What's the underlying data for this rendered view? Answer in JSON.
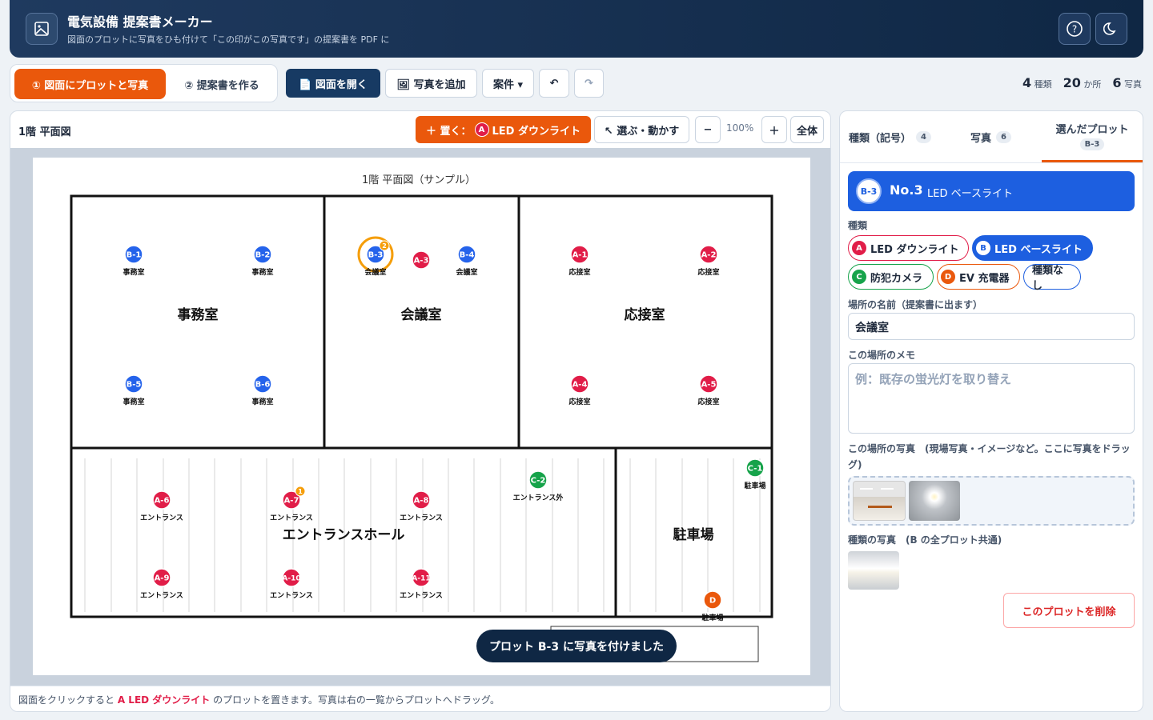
{
  "header": {
    "title": "電気設備 提案書メーカー",
    "subtitle": "図面のプロットに写真をひも付けて「この印がこの写真です」の提案書を PDF に"
  },
  "toolbar": {
    "step1": "① 図面にプロットと写真",
    "step2": "② 提案書を作る",
    "open": "📄 図面を開く",
    "add_photo": "🖼 写真を追加",
    "project": "案件 ▾",
    "undo": "↶",
    "redo": "↷"
  },
  "stats": {
    "types_n": "4",
    "types_l": "種類",
    "places_n": "20",
    "places_l": "か所",
    "photos_n": "6",
    "photos_l": "写真"
  },
  "left": {
    "title": "1階 平面図",
    "place_prefix": "＋ 置く：",
    "place_letter": "A",
    "place_label": "LED ダウンライト",
    "select": "↖ 選ぶ・動かす",
    "zoom_out": "−",
    "zoom": "100%",
    "zoom_in": "＋",
    "fit": "全体",
    "footer_pre": "図面をクリックすると ",
    "footer_key": "A LED ダウンライト",
    "footer_post": " のプロットを置きます。写真は右の一覧からプロットへドラッグ。"
  },
  "plan": {
    "caption": "1階 平面図（サンプル）",
    "rooms": [
      "事務室",
      "会議室",
      "応接室",
      "エントランスホール",
      "駐車場"
    ]
  },
  "plots": [
    {
      "id": "B-1",
      "label": "事務室",
      "color": "#2563eb"
    },
    {
      "id": "B-2",
      "label": "事務室",
      "color": "#2563eb"
    },
    {
      "id": "B-3",
      "label": "会議室",
      "color": "#2563eb",
      "photos": "2",
      "selected": true
    },
    {
      "id": "A-3",
      "label": "",
      "color": "#e11d48"
    },
    {
      "id": "B-4",
      "label": "会議室",
      "color": "#2563eb"
    },
    {
      "id": "A-1",
      "label": "応接室",
      "color": "#e11d48"
    },
    {
      "id": "A-2",
      "label": "応接室",
      "color": "#e11d48"
    },
    {
      "id": "B-5",
      "label": "事務室",
      "color": "#2563eb"
    },
    {
      "id": "B-6",
      "label": "事務室",
      "color": "#2563eb"
    },
    {
      "id": "A-4",
      "label": "応接室",
      "color": "#e11d48"
    },
    {
      "id": "A-5",
      "label": "応接室",
      "color": "#e11d48"
    },
    {
      "id": "C-2",
      "label": "エントランス外",
      "color": "#16a34a"
    },
    {
      "id": "C-1",
      "label": "駐車場",
      "color": "#16a34a"
    },
    {
      "id": "A-6",
      "label": "エントランス",
      "color": "#e11d48"
    },
    {
      "id": "A-7",
      "label": "エントランス",
      "color": "#e11d48",
      "photos": "1"
    },
    {
      "id": "A-8",
      "label": "エントランス",
      "color": "#e11d48"
    },
    {
      "id": "A-9",
      "label": "エントランス",
      "color": "#e11d48"
    },
    {
      "id": "A-10",
      "label": "エントランス",
      "color": "#e11d48"
    },
    {
      "id": "A-11",
      "label": "エントランス",
      "color": "#e11d48"
    },
    {
      "id": "D",
      "label": "駐車場",
      "color": "#ea580c"
    }
  ],
  "toast": "プロット B-3 に写真を付けました",
  "right": {
    "tabs": [
      {
        "label": "種類（記号）",
        "count": "4"
      },
      {
        "label": "写真",
        "count": "6"
      },
      {
        "label": "選んだプロット",
        "count": "B-3"
      }
    ],
    "selected": {
      "badge": "B-3",
      "no": "No.3",
      "type": "LED ベースライト"
    },
    "type_label": "種類",
    "types": [
      {
        "letter": "A",
        "name": "LED ダウンライト",
        "color": "#e11d48"
      },
      {
        "letter": "B",
        "name": "LED ベースライト",
        "color": "#1d5fe0"
      },
      {
        "letter": "C",
        "name": "防犯カメラ",
        "color": "#16a34a"
      },
      {
        "letter": "D",
        "name": "EV 充電器",
        "color": "#ea580c"
      },
      {
        "letter": "",
        "name": "種類なし",
        "color": "#1d5fe0"
      }
    ],
    "place_label": "場所の名前（提案書に出ます）",
    "place_value": "会議室",
    "memo_label": "この場所のメモ",
    "memo_placeholder": "例：既存の蛍光灯を取り替え",
    "photos_label": "この場所の写真　(現場写真・イメージなど。ここに写真をドラッグ)",
    "type_photos_label": "種類の写真　(B の全プロット共通)",
    "delete": "このプロットを削除"
  }
}
